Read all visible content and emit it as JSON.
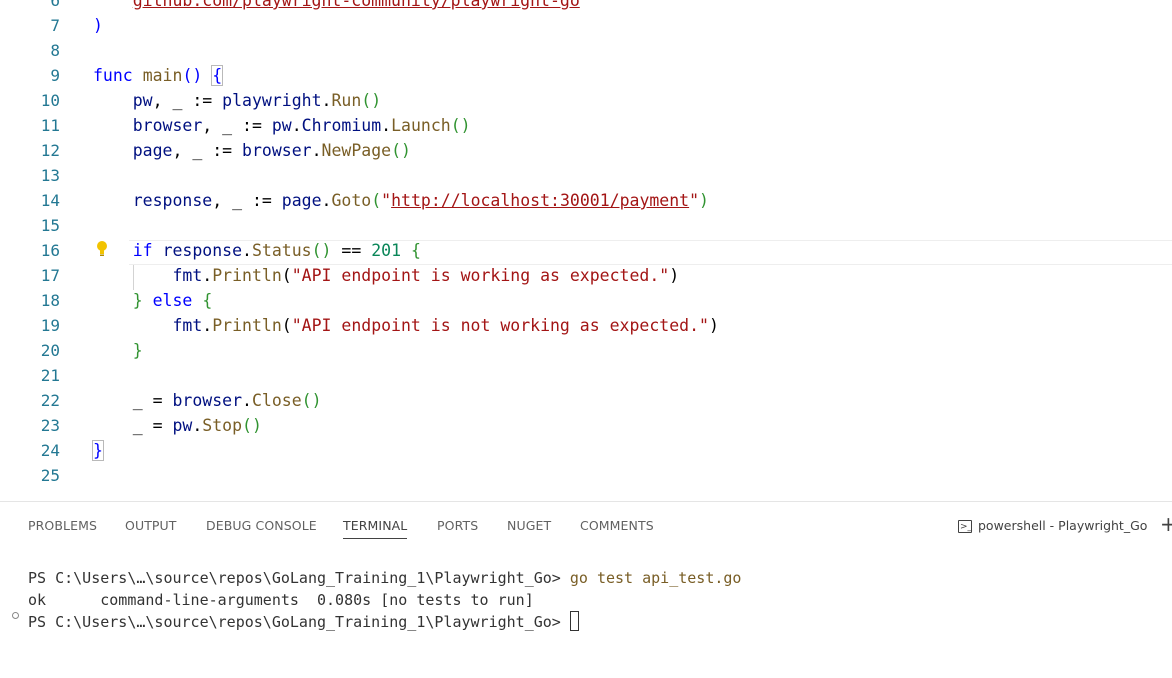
{
  "editor": {
    "lines": [
      {
        "num": "6",
        "segments": [
          {
            "text": "    "
          },
          {
            "text": "github.com/playwright-community/playwright-go",
            "cls": "u"
          }
        ]
      },
      {
        "num": "7",
        "segments": [
          {
            "text": ")",
            "cls": "k"
          }
        ]
      },
      {
        "num": "8",
        "segments": []
      },
      {
        "num": "9",
        "segments": [
          {
            "text": "func",
            "cls": "k"
          },
          {
            "text": " "
          },
          {
            "text": "main",
            "cls": "f"
          },
          {
            "text": "()",
            "cls": "k"
          },
          {
            "text": " "
          },
          {
            "text": "{",
            "cls": "k bm"
          }
        ]
      },
      {
        "num": "10",
        "segments": [
          {
            "text": "    "
          },
          {
            "text": "pw",
            "cls": "v"
          },
          {
            "text": ", _ := "
          },
          {
            "text": "playwright",
            "cls": "v"
          },
          {
            "text": "."
          },
          {
            "text": "Run",
            "cls": "f"
          },
          {
            "text": "()",
            "cls": "pg"
          }
        ]
      },
      {
        "num": "11",
        "segments": [
          {
            "text": "    "
          },
          {
            "text": "browser",
            "cls": "v"
          },
          {
            "text": ", _ := "
          },
          {
            "text": "pw",
            "cls": "v"
          },
          {
            "text": "."
          },
          {
            "text": "Chromium",
            "cls": "v"
          },
          {
            "text": "."
          },
          {
            "text": "Launch",
            "cls": "f"
          },
          {
            "text": "()",
            "cls": "pg"
          }
        ]
      },
      {
        "num": "12",
        "segments": [
          {
            "text": "    "
          },
          {
            "text": "page",
            "cls": "v"
          },
          {
            "text": ", _ := "
          },
          {
            "text": "browser",
            "cls": "v"
          },
          {
            "text": "."
          },
          {
            "text": "NewPage",
            "cls": "f"
          },
          {
            "text": "()",
            "cls": "pg"
          }
        ]
      },
      {
        "num": "13",
        "segments": []
      },
      {
        "num": "14",
        "segments": [
          {
            "text": "    "
          },
          {
            "text": "response",
            "cls": "v"
          },
          {
            "text": ", _ := "
          },
          {
            "text": "page",
            "cls": "v"
          },
          {
            "text": "."
          },
          {
            "text": "Goto",
            "cls": "f"
          },
          {
            "text": "(",
            "cls": "pg"
          },
          {
            "text": "\"",
            "cls": "s"
          },
          {
            "text": "http://localhost:30001/payment",
            "cls": "u"
          },
          {
            "text": "\"",
            "cls": "s"
          },
          {
            "text": ")",
            "cls": "pg"
          }
        ]
      },
      {
        "num": "15",
        "segments": []
      },
      {
        "num": "16",
        "segments": [
          {
            "text": "    "
          },
          {
            "text": "if",
            "cls": "k"
          },
          {
            "text": " "
          },
          {
            "text": "response",
            "cls": "v"
          },
          {
            "text": "."
          },
          {
            "text": "Status",
            "cls": "f"
          },
          {
            "text": "()",
            "cls": "pg"
          },
          {
            "text": " == "
          },
          {
            "text": "201",
            "cls": "n"
          },
          {
            "text": " "
          },
          {
            "text": "{",
            "cls": "pg"
          }
        ]
      },
      {
        "num": "17",
        "segments": [
          {
            "text": "        "
          },
          {
            "text": "fmt",
            "cls": "v"
          },
          {
            "text": "."
          },
          {
            "text": "Println",
            "cls": "f"
          },
          {
            "text": "("
          },
          {
            "text": "\"API endpoint is working as expected.\"",
            "cls": "s"
          },
          {
            "text": ")"
          }
        ]
      },
      {
        "num": "18",
        "segments": [
          {
            "text": "    "
          },
          {
            "text": "}",
            "cls": "pg"
          },
          {
            "text": " "
          },
          {
            "text": "else",
            "cls": "k"
          },
          {
            "text": " "
          },
          {
            "text": "{",
            "cls": "pg"
          }
        ]
      },
      {
        "num": "19",
        "segments": [
          {
            "text": "        "
          },
          {
            "text": "fmt",
            "cls": "v"
          },
          {
            "text": "."
          },
          {
            "text": "Println",
            "cls": "f"
          },
          {
            "text": "("
          },
          {
            "text": "\"API endpoint is not working as expected.\"",
            "cls": "s"
          },
          {
            "text": ")"
          }
        ]
      },
      {
        "num": "20",
        "segments": [
          {
            "text": "    "
          },
          {
            "text": "}",
            "cls": "pg"
          }
        ]
      },
      {
        "num": "21",
        "segments": []
      },
      {
        "num": "22",
        "segments": [
          {
            "text": "    _ = "
          },
          {
            "text": "browser",
            "cls": "v"
          },
          {
            "text": "."
          },
          {
            "text": "Close",
            "cls": "f"
          },
          {
            "text": "()",
            "cls": "pg"
          }
        ]
      },
      {
        "num": "23",
        "segments": [
          {
            "text": "    _ = "
          },
          {
            "text": "pw",
            "cls": "v"
          },
          {
            "text": "."
          },
          {
            "text": "Stop",
            "cls": "f"
          },
          {
            "text": "()",
            "cls": "pg"
          }
        ]
      },
      {
        "num": "24",
        "segments": [
          {
            "text": "}",
            "cls": "k bm"
          }
        ]
      },
      {
        "num": "25",
        "segments": []
      }
    ]
  },
  "panel": {
    "tabs": [
      {
        "label": "PROBLEMS",
        "name": "tab-problems",
        "active": false
      },
      {
        "label": "OUTPUT",
        "name": "tab-output",
        "active": false
      },
      {
        "label": "DEBUG CONSOLE",
        "name": "tab-debug-console",
        "active": false
      },
      {
        "label": "TERMINAL",
        "name": "tab-terminal",
        "active": true
      },
      {
        "label": "PORTS",
        "name": "tab-ports",
        "active": false
      },
      {
        "label": "NUGET",
        "name": "tab-nuget",
        "active": false
      },
      {
        "label": "COMMENTS",
        "name": "tab-comments",
        "active": false
      }
    ],
    "shell_label": "powershell - Playwright_Go",
    "shell_icon": "terminal-icon",
    "new_terminal_label": "+"
  },
  "terminal": {
    "line1_prompt": "PS C:\\Users\\…\\source\\repos\\GoLang_Training_1\\Playwright_Go> ",
    "line1_command": "go test api_test.go",
    "line2": "ok      command-line-arguments  0.080s [no tests to run]",
    "line3_prompt": "PS C:\\Users\\…\\source\\repos\\GoLang_Training_1\\Playwright_Go> "
  },
  "colors": {
    "accent": "#424242",
    "line_number": "#237893",
    "keyword": "#0000ff",
    "string": "#a31515",
    "bulb": "#f2c300"
  }
}
